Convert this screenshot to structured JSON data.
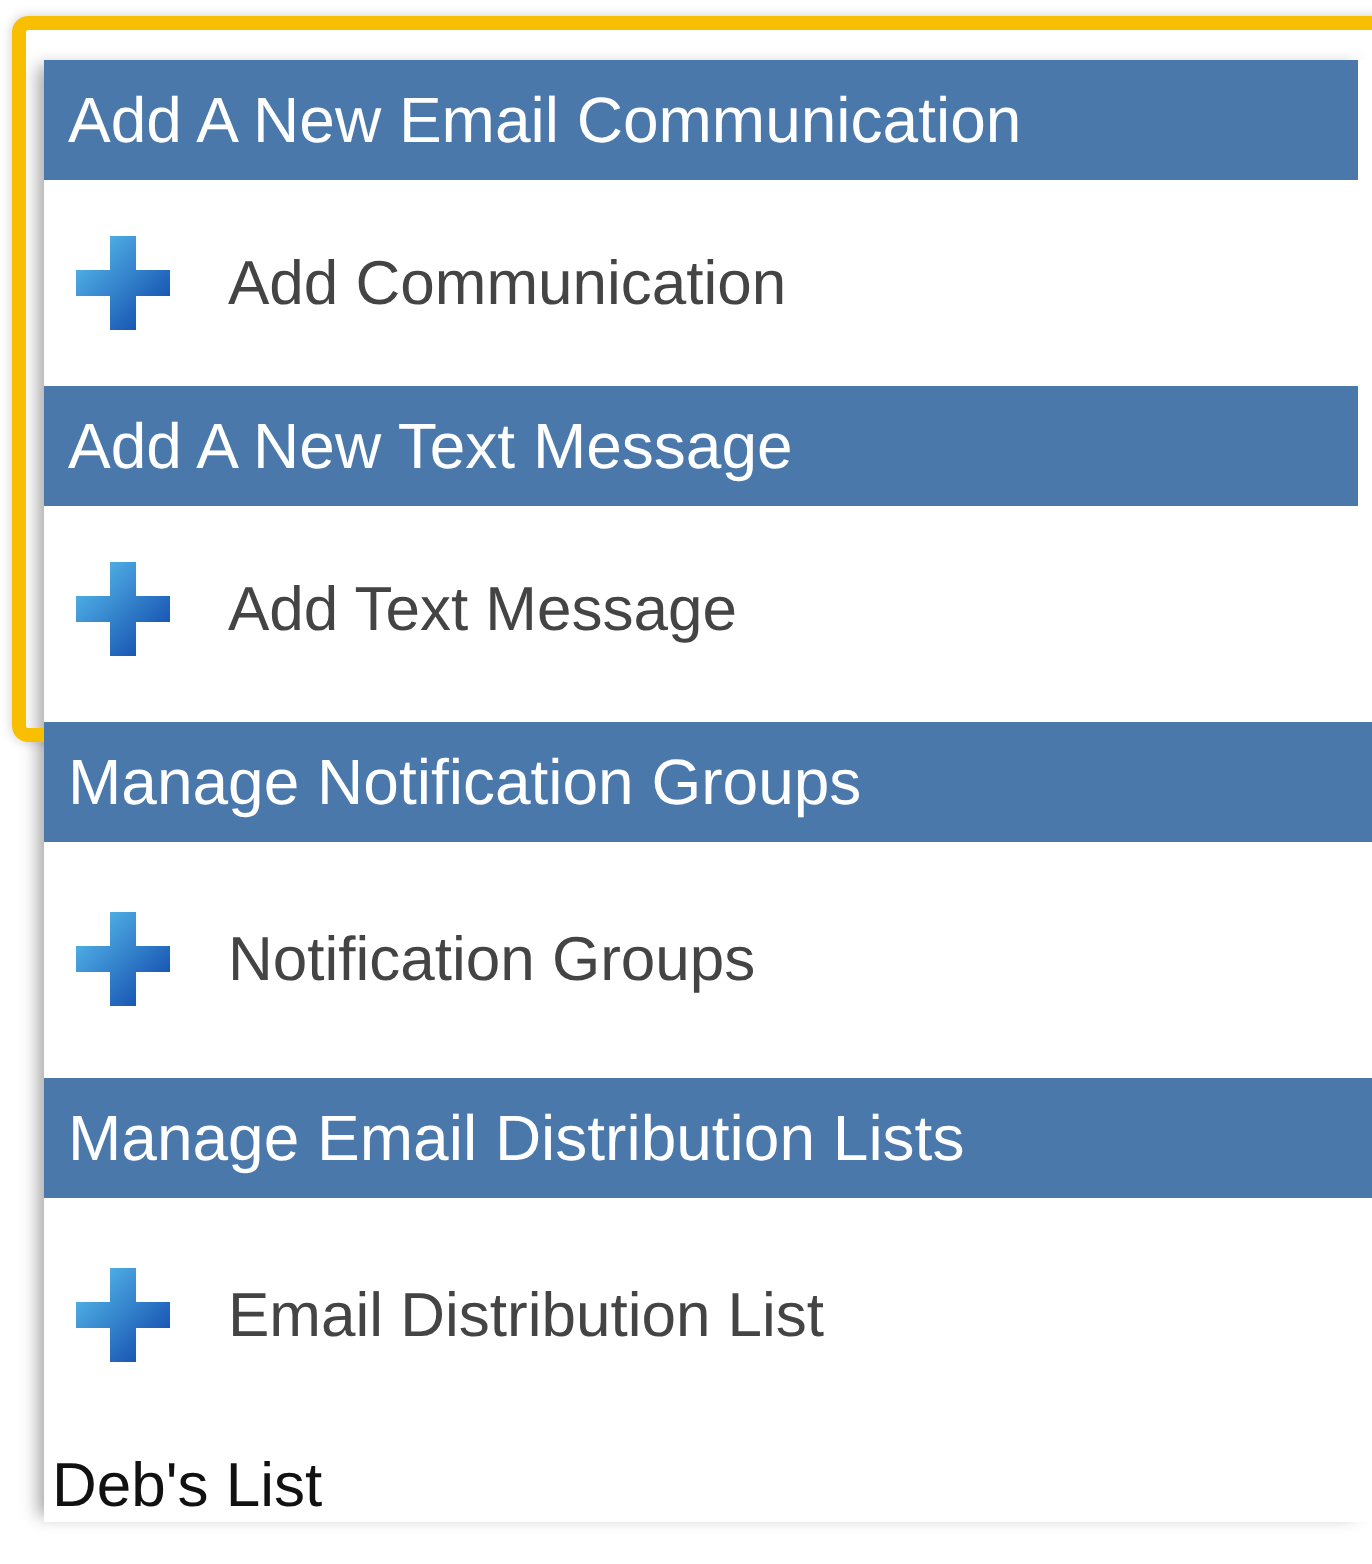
{
  "sections": [
    {
      "title": "Add A New Email Communication",
      "item": "Add Communication",
      "highlighted": true
    },
    {
      "title": "Add A New Text Message",
      "item": "Add Text Message",
      "highlighted": true
    },
    {
      "title": "Manage Notification Groups",
      "item": "Notification Groups",
      "highlighted": false
    },
    {
      "title": "Manage Email Distribution Lists",
      "item": "Email Distribution List",
      "highlighted": false
    }
  ],
  "footer_heading": "Deb's List"
}
